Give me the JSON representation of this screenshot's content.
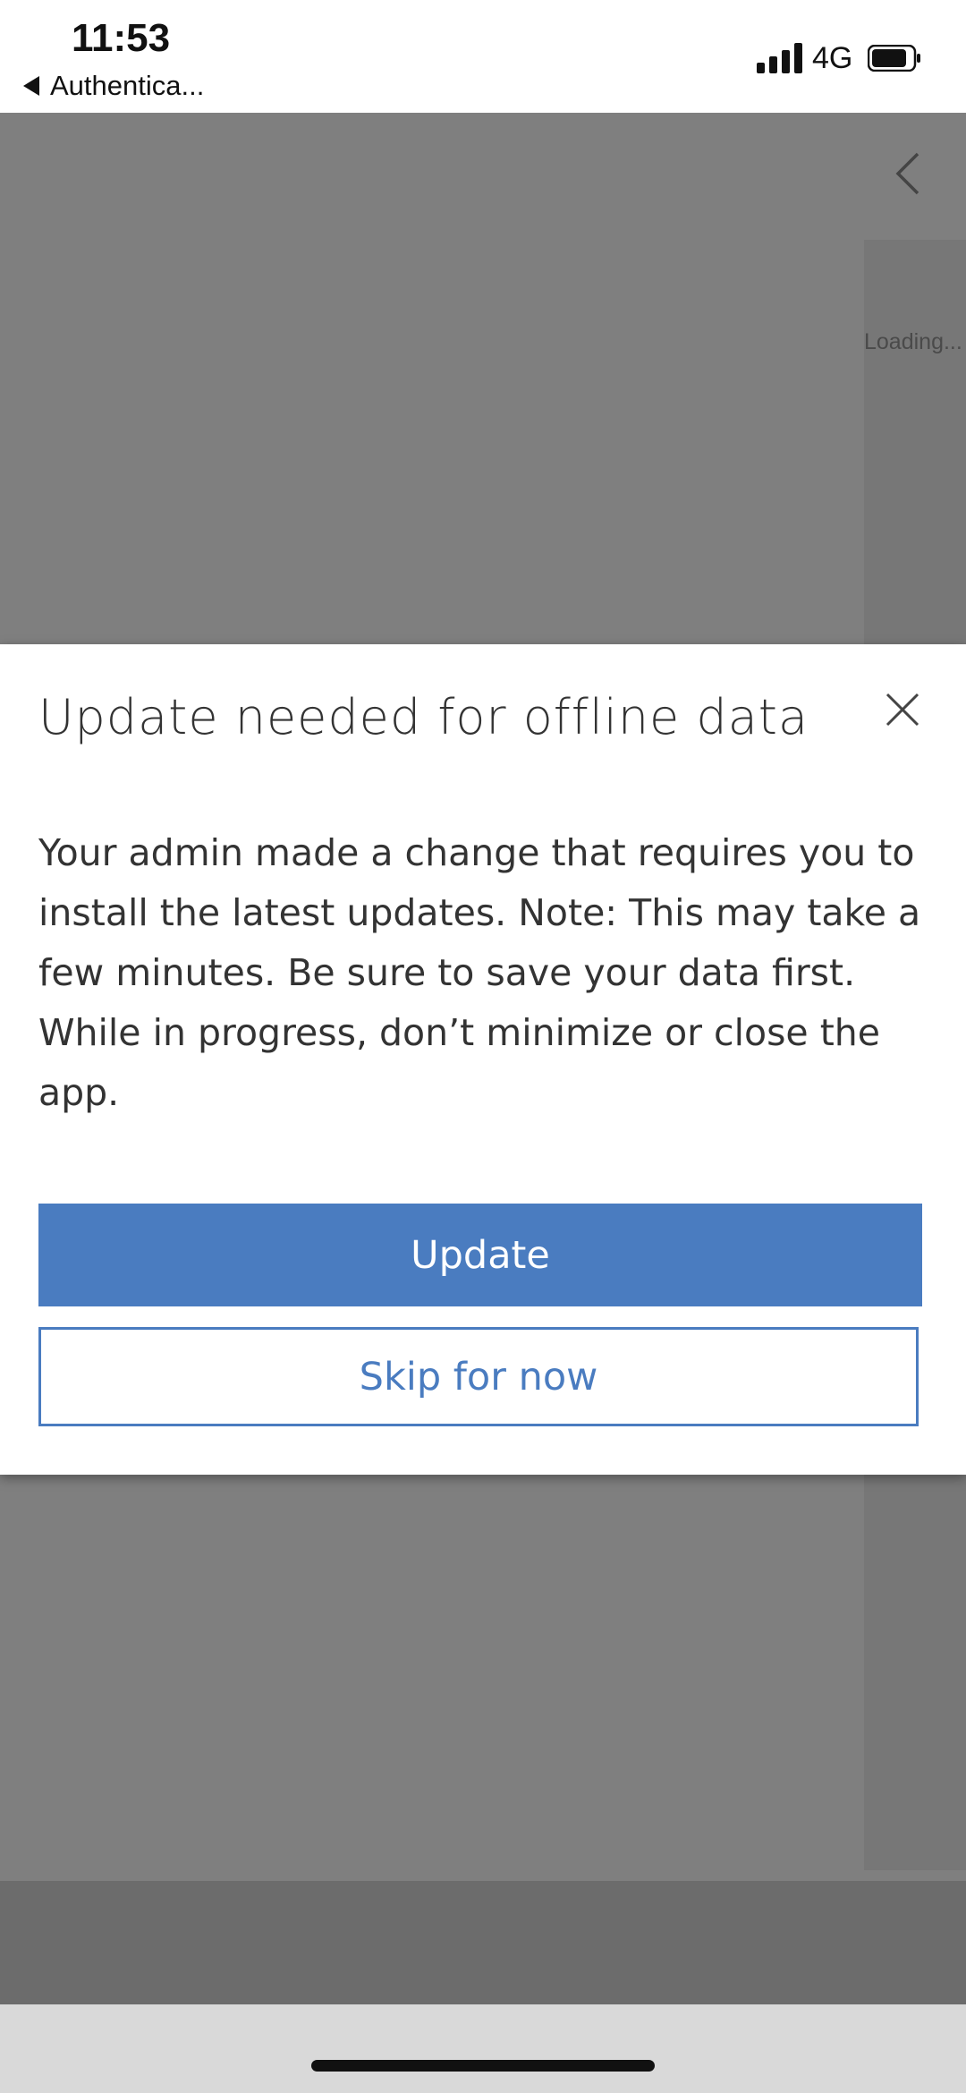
{
  "status_bar": {
    "time": "11:53",
    "back_app_label": "Authentica...",
    "network": "4G"
  },
  "background": {
    "loading_text": "Loading..."
  },
  "dialog": {
    "title": "Update needed for offline data",
    "body": "Your admin made a change that requires you to install the latest updates. Note: This may take a few minutes. Be sure to save your data first. While in progress, don’t minimize or close the app.",
    "update_label": "Update",
    "skip_label": "Skip for now"
  },
  "colors": {
    "accent": "#4a7cc0",
    "overlay": "#7f7f7f"
  },
  "icons": [
    "back-arrow-icon",
    "signal-icon",
    "battery-icon",
    "chevron-left-icon",
    "close-icon"
  ]
}
